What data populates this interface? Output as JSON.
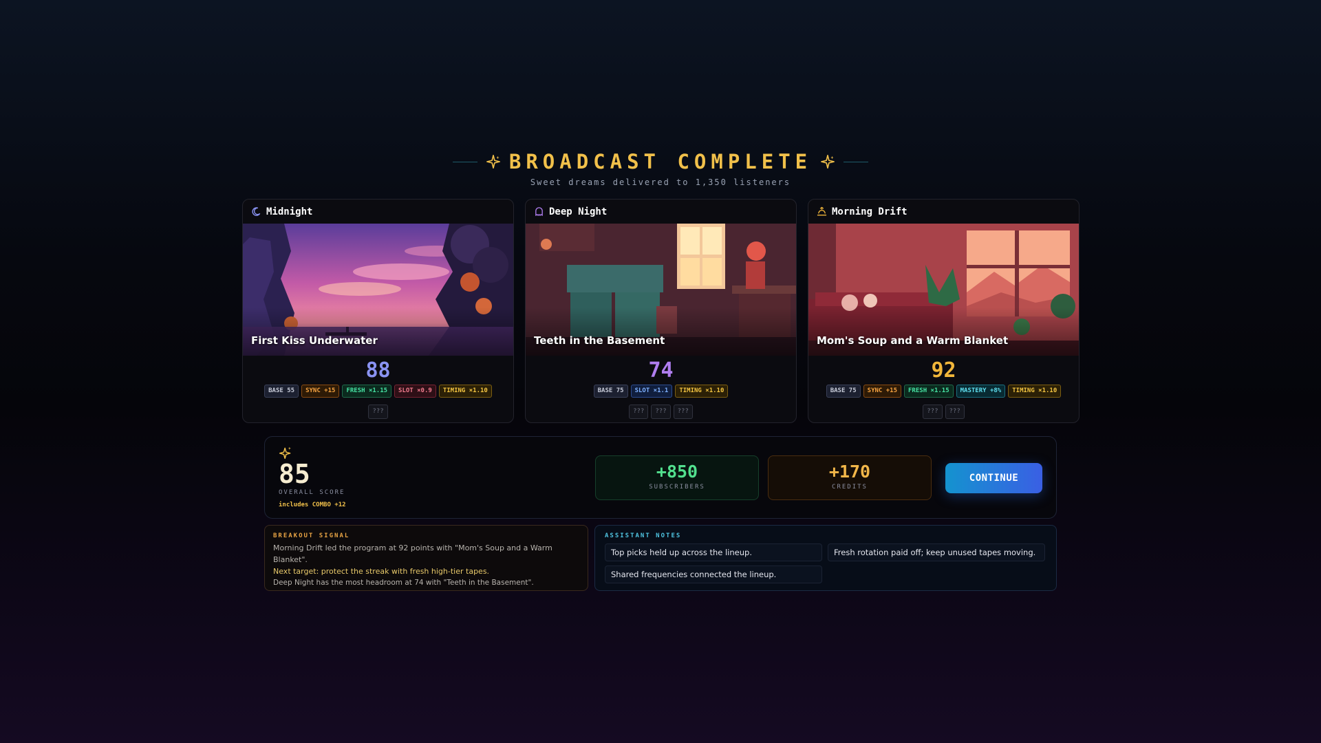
{
  "header": {
    "title": "BROADCAST COMPLETE",
    "subtitle": "Sweet dreams delivered to 1,350 listeners",
    "accent": "#f1c04a"
  },
  "cards": [
    {
      "slot": "Midnight",
      "slot_icon": "moon-icon",
      "tape_title": "First Kiss Underwater",
      "score": "88",
      "score_color": "#8a93f2",
      "chips": [
        {
          "label": "BASE 55",
          "kind": "base"
        },
        {
          "label": "SYNC +15",
          "kind": "sync"
        },
        {
          "label": "FRESH ×1.15",
          "kind": "fresh"
        },
        {
          "label": "SLOT ×0.9",
          "kind": "slot"
        },
        {
          "label": "TIMING ×1.10",
          "kind": "timing"
        }
      ],
      "hidden": [
        "???"
      ]
    },
    {
      "slot": "Deep Night",
      "slot_icon": "ghost-icon",
      "tape_title": "Teeth in the Basement",
      "score": "74",
      "score_color": "#b07ef0",
      "chips": [
        {
          "label": "BASE 75",
          "kind": "base"
        },
        {
          "label": "SLOT ×1.1",
          "kind": "slotup"
        },
        {
          "label": "TIMING ×1.10",
          "kind": "timing"
        }
      ],
      "hidden": [
        "???",
        "???",
        "???"
      ]
    },
    {
      "slot": "Morning Drift",
      "slot_icon": "sunrise-icon",
      "tape_title": "Mom's Soup and a Warm Blanket",
      "score": "92",
      "score_color": "#f1b63a",
      "chips": [
        {
          "label": "BASE 75",
          "kind": "base"
        },
        {
          "label": "SYNC +15",
          "kind": "sync"
        },
        {
          "label": "FRESH ×1.15",
          "kind": "fresh"
        },
        {
          "label": "MASTERY +8%",
          "kind": "mastery"
        },
        {
          "label": "TIMING ×1.10",
          "kind": "timing"
        }
      ],
      "hidden": [
        "???",
        "???"
      ]
    }
  ],
  "summary": {
    "overall_score": "85",
    "overall_label": "OVERALL SCORE",
    "combo": "includes COMBO +12",
    "subscribers_value": "+850",
    "subscribers_label": "SUBSCRIBERS",
    "credits_value": "+170",
    "credits_label": "CREDITS",
    "continue_label": "CONTINUE"
  },
  "breakout": {
    "title": "BREAKOUT SIGNAL",
    "line1": "Morning Drift led the program at 92 points with \"Mom's Soup and a Warm Blanket\".",
    "line2": "Next target: protect the streak with fresh high-tier tapes.",
    "line3": "Deep Night has the most headroom at 74 with \"Teeth in the Basement\"."
  },
  "notes": {
    "title": "ASSISTANT NOTES",
    "items": [
      "Top picks held up across the lineup.",
      "Fresh rotation paid off; keep unused tapes moving.",
      "Shared frequencies connected the lineup."
    ]
  }
}
